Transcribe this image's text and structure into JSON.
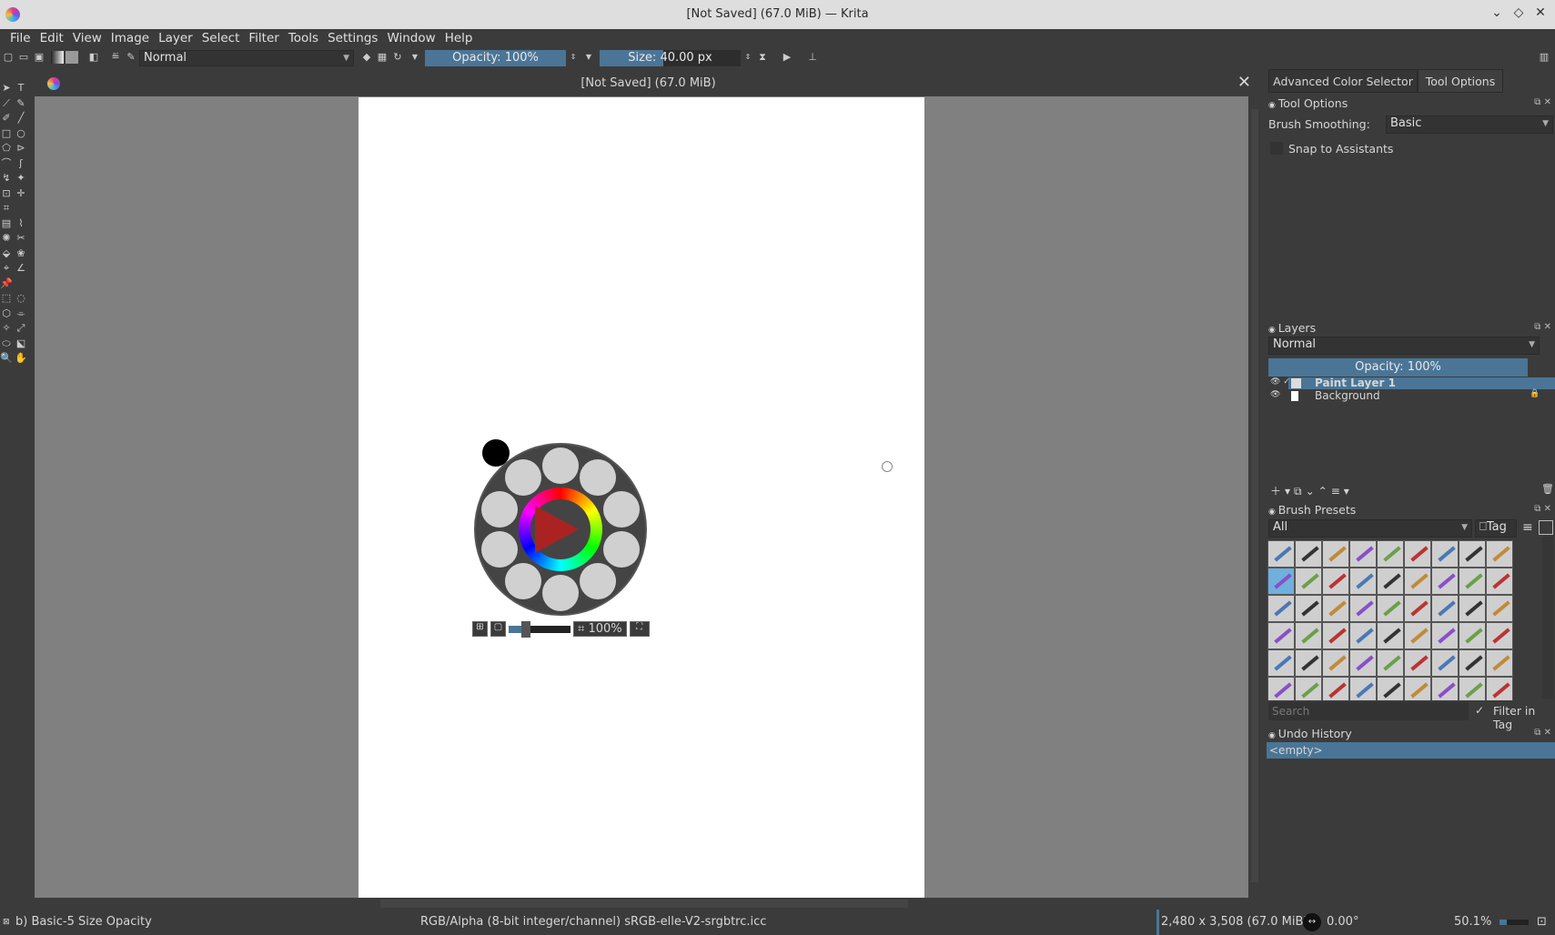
{
  "window": {
    "title": "[Not Saved] (67.0 MiB) — Krita"
  },
  "menu": [
    "File",
    "Edit",
    "View",
    "Image",
    "Layer",
    "Select",
    "Filter",
    "Tools",
    "Settings",
    "Window",
    "Help"
  ],
  "toolbar": {
    "blend_mode": "Normal",
    "opacity_label": "Opacity: 100%",
    "opacity_fraction": 1.0,
    "size_label": "Size: 40.00 px",
    "size_fraction": 0.45
  },
  "document": {
    "title": "[Not Saved]  (67.0 MiB)"
  },
  "dock": {
    "tabs": [
      "Advanced Color Selector",
      "Tool Options"
    ],
    "tool_options": {
      "title": "Tool Options",
      "brush_smoothing_label": "Brush Smoothing:",
      "brush_smoothing_value": "Basic",
      "snap_label": "Snap to Assistants"
    },
    "layers": {
      "title": "Layers",
      "blend_mode": "Normal",
      "opacity_label": "Opacity:  100%",
      "items": [
        {
          "name": "Paint Layer 1",
          "selected": true
        },
        {
          "name": "Background",
          "selected": false
        }
      ]
    },
    "brush_presets": {
      "title": "Brush Presets",
      "filter": "All",
      "tag_label": "Tag",
      "search_placeholder": "Search",
      "filter_in_tag": "Filter in Tag"
    },
    "undo": {
      "title": "Undo History",
      "items": [
        "<empty>"
      ]
    }
  },
  "popup": {
    "zoom": "100%"
  },
  "status": {
    "preset": "b) Basic-5 Size Opacity",
    "color_space": "RGB/Alpha (8-bit integer/channel)  sRGB-elle-V2-srgbtrc.icc",
    "dimensions": "2,480 x 3,508 (67.0 MiB)",
    "rotation": "0.00°",
    "zoom": "50.1%"
  },
  "colors": {
    "accent": "#4a7596",
    "canvas": "#808080",
    "panel": "#3b3b3b"
  }
}
